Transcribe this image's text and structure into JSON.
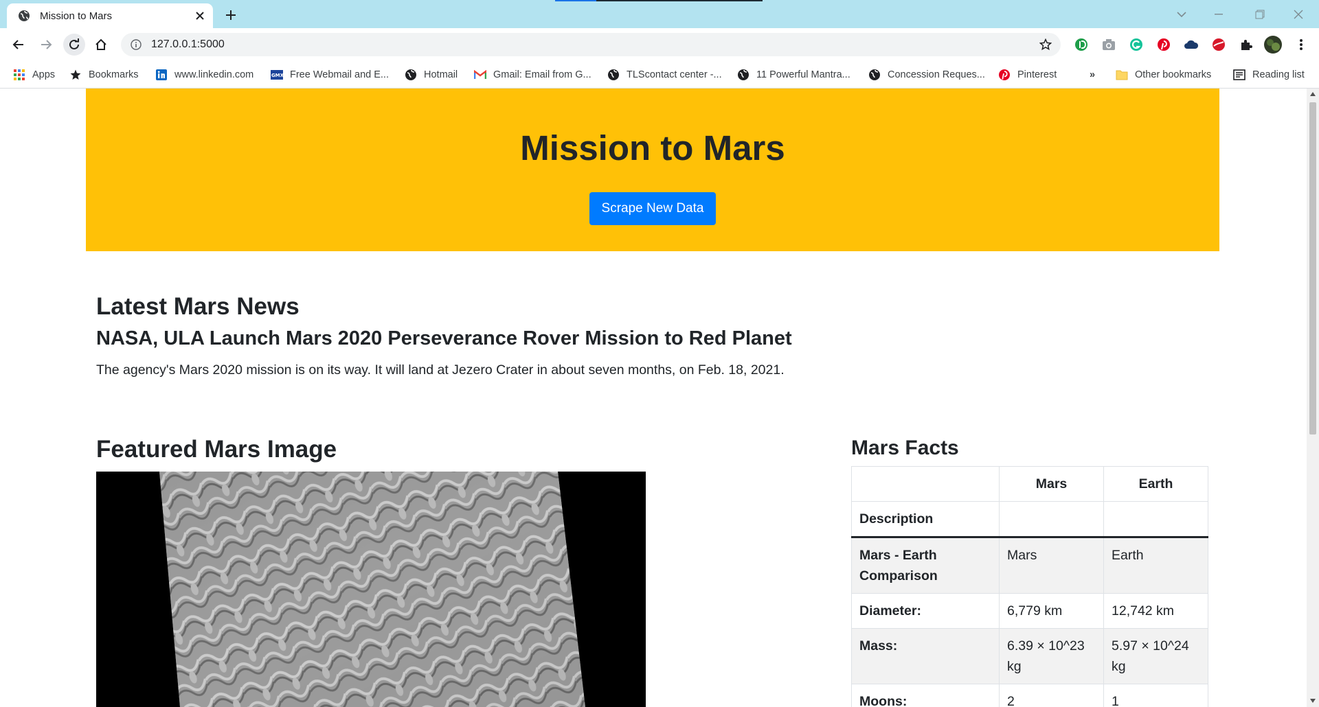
{
  "browser": {
    "tab_title": "Mission to Mars",
    "url": "127.0.0.1:5000",
    "bookmarks": [
      {
        "label": "Apps",
        "icon": "apps-grid-icon"
      },
      {
        "label": "Bookmarks",
        "icon": "star-icon"
      },
      {
        "label": "www.linkedin.com",
        "icon": "linkedin-icon"
      },
      {
        "label": "Free Webmail and E...",
        "icon": "gmx-icon"
      },
      {
        "label": "Hotmail",
        "icon": "globe-icon"
      },
      {
        "label": "Gmail: Email from G...",
        "icon": "gmail-icon"
      },
      {
        "label": "TLScontact center -...",
        "icon": "globe-icon"
      },
      {
        "label": "11 Powerful Mantra...",
        "icon": "globe-icon"
      },
      {
        "label": "Concession Reques...",
        "icon": "globe-icon"
      },
      {
        "label": "Pinterest",
        "icon": "pinterest-icon"
      }
    ],
    "overflow_label": "»",
    "other_bookmarks": "Other bookmarks",
    "reading_list": "Reading list"
  },
  "page": {
    "title": "Mission to Mars",
    "scrape_button": "Scrape New Data",
    "news_heading": "Latest Mars News",
    "news_title": "NASA, ULA Launch Mars 2020 Perseverance Rover Mission to Red Planet",
    "news_paragraph": "The agency's Mars 2020 mission is on its way. It will land at Jezero Crater in about seven months, on Feb. 18, 2021.",
    "featured_heading": "Featured Mars Image",
    "facts_heading": "Mars Facts",
    "facts_table": {
      "col_mars": "Mars",
      "col_earth": "Earth",
      "index_label": "Description",
      "rows": [
        {
          "label": "Mars - Earth Comparison",
          "mars": "Mars",
          "earth": "Earth"
        },
        {
          "label": "Diameter:",
          "mars": "6,779 km",
          "earth": "12,742 km"
        },
        {
          "label": "Mass:",
          "mars": "6.39 × 10^23 kg",
          "earth": "5.97 × 10^24 kg"
        },
        {
          "label": "Moons:",
          "mars": "2",
          "earth": "1"
        }
      ]
    }
  },
  "colors": {
    "tab_strip": "#b3e3f0",
    "jumbotron": "#ffc107",
    "primary_button": "#007bff"
  }
}
